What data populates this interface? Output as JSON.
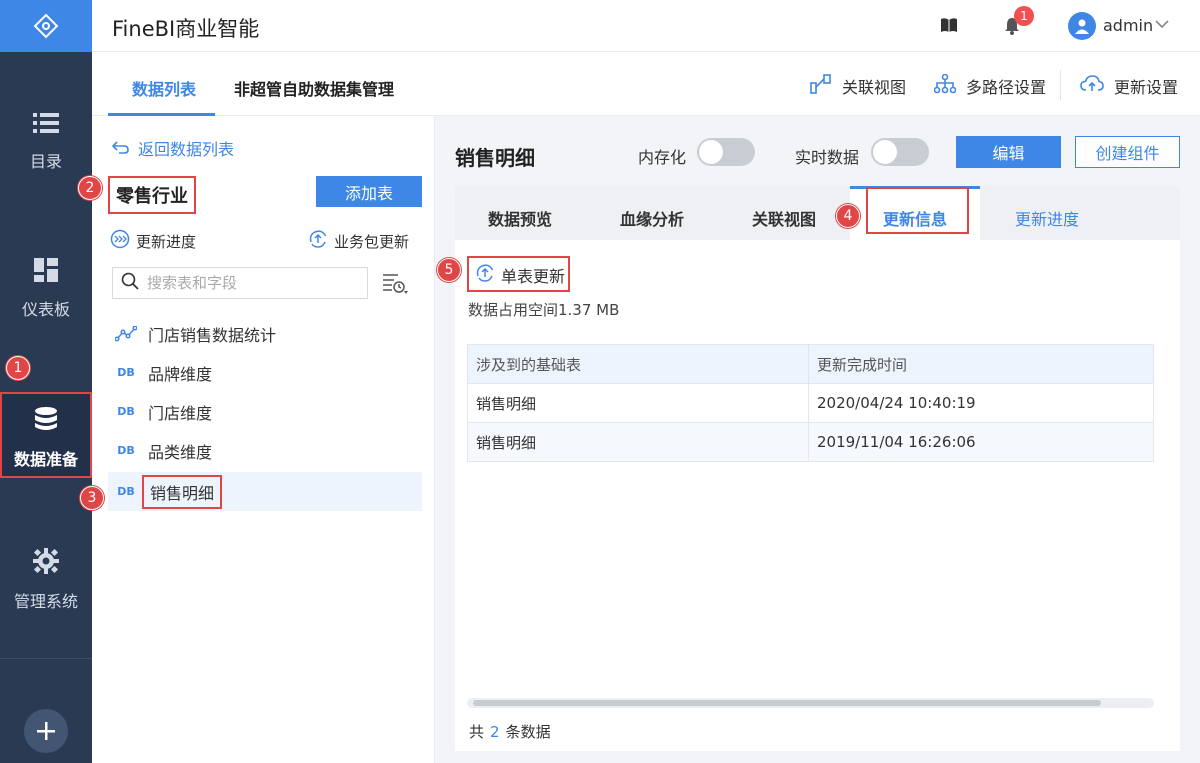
{
  "app": {
    "title": "FineBI商业智能"
  },
  "header": {
    "notification_count": "1",
    "user": "admin"
  },
  "rail": {
    "items": [
      {
        "label": "目录",
        "icon": "list-icon"
      },
      {
        "label": "仪表板",
        "icon": "dashboard-icon"
      },
      {
        "label": "数据准备",
        "icon": "database-icon"
      },
      {
        "label": "管理系统",
        "icon": "gear-icon"
      }
    ]
  },
  "topbar": {
    "tabs": [
      {
        "label": "数据列表"
      },
      {
        "label": "非超管自助数据集管理"
      }
    ],
    "tools": [
      {
        "label": "关联视图"
      },
      {
        "label": "多路径设置"
      },
      {
        "label": "更新设置"
      }
    ]
  },
  "left": {
    "back_label": "返回数据列表",
    "package_title": "零售行业",
    "add_table_label": "添加表",
    "update_progress_label": "更新进度",
    "package_update_label": "业务包更新",
    "search_placeholder": "搜索表和字段",
    "db_badge": "DB",
    "tables": [
      {
        "label": "门店销售数据统计",
        "type": "analysis"
      },
      {
        "label": "品牌维度",
        "type": "db"
      },
      {
        "label": "门店维度",
        "type": "db"
      },
      {
        "label": "品类维度",
        "type": "db"
      },
      {
        "label": "销售明细",
        "type": "db"
      }
    ]
  },
  "detail": {
    "title": "销售明细",
    "toggle_memory": "内存化",
    "toggle_realtime": "实时数据",
    "edit_label": "编辑",
    "create_label": "创建组件",
    "tabs": [
      "数据预览",
      "血缘分析",
      "关联视图",
      "更新信息",
      "更新进度"
    ],
    "single_update_label": "单表更新",
    "space_text": "数据占用空间1.37 MB",
    "table": {
      "headers": [
        "涉及到的基础表",
        "更新完成时间"
      ],
      "rows": [
        [
          "销售明细",
          "2020/04/24 10:40:19"
        ],
        [
          "销售明细",
          "2019/11/04 16:26:06"
        ]
      ]
    },
    "count_prefix": "共",
    "count_value": "2",
    "count_suffix": "条数据"
  },
  "steps": [
    "1",
    "2",
    "3",
    "4",
    "5"
  ],
  "colors": {
    "accent": "#3f87e6",
    "rail": "#2a3a52",
    "highlight": "#e04646"
  }
}
